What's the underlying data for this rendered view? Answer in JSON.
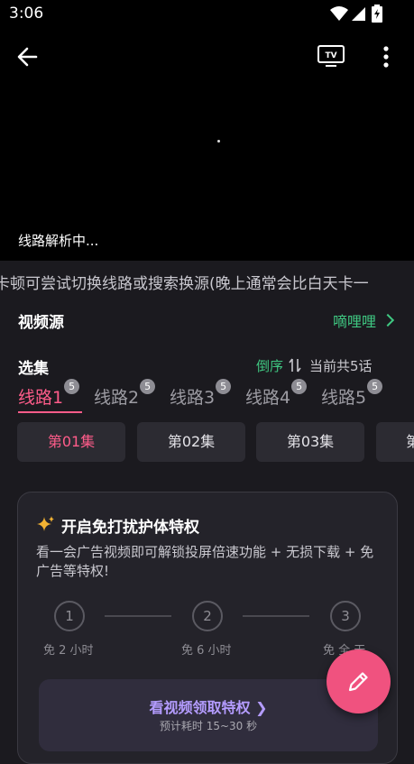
{
  "status_bar": {
    "time": "3:06"
  },
  "player": {
    "parsing_text": "线路解析中..."
  },
  "notice": {
    "text": "卡顿可尝试切换线路或搜索换源(晚上通常会比白天卡一"
  },
  "source": {
    "label": "视频源",
    "value": "嘀哩哩"
  },
  "episodes": {
    "label": "选集",
    "order_label": "倒序",
    "total_label": "当前共5话",
    "routes": [
      {
        "label": "线路1",
        "count": "5"
      },
      {
        "label": "线路2",
        "count": "5"
      },
      {
        "label": "线路3",
        "count": "5"
      },
      {
        "label": "线路4",
        "count": "5"
      },
      {
        "label": "线路5",
        "count": "5"
      }
    ],
    "items": [
      "第01集",
      "第02集",
      "第03集",
      "第"
    ]
  },
  "privilege_card": {
    "title": "开启免打扰护体特权",
    "description": "看一会广告视频即可解锁投屏倍速功能 + 无损下载 + 免广告等特权!",
    "steps": [
      {
        "num": "1",
        "label": "免 2 小时"
      },
      {
        "num": "2",
        "label": "免 6 小时"
      },
      {
        "num": "3",
        "label": "免 全 天"
      }
    ],
    "cta_title": "看视频领取特权 ❯",
    "cta_sub": "预计耗时 15~30 秒"
  },
  "colors": {
    "accent_pink": "#ff5c8a",
    "accent_green": "#3fc781",
    "accent_purple": "#b49cff",
    "fab": "#f0527f"
  }
}
